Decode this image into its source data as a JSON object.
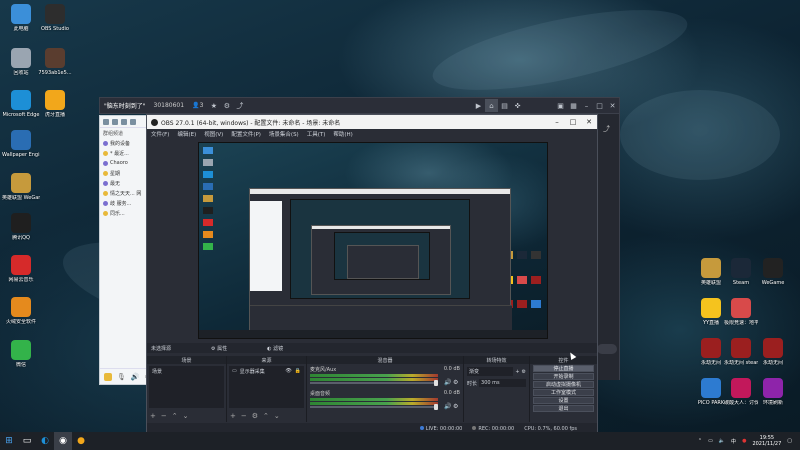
{
  "desktop": {
    "left_icons": [
      {
        "label": "此电脑",
        "icon": "computer-icon",
        "color": "#3b8fd9"
      },
      {
        "label": "OBS Studio",
        "icon": "obs-icon",
        "color": "#2d2d2d"
      },
      {
        "label": "回收站",
        "icon": "recycle-bin-icon",
        "color": "#9aa5b1"
      },
      {
        "label": "7593ab1e5...",
        "icon": "image-file-icon",
        "color": "#5a3d2f"
      },
      {
        "label": "Microsoft Edge",
        "icon": "edge-icon",
        "color": "#1d8fd6"
      },
      {
        "label": "虎牙直播",
        "icon": "huya-icon",
        "color": "#f2a71b"
      },
      {
        "label": "Wallpaper Engine:...",
        "icon": "wallpaper-engine-icon",
        "color": "#2a6db3"
      },
      {
        "label": "英雄联盟 WeGame版",
        "icon": "lol-icon",
        "color": "#c69a3c"
      },
      {
        "label": "腾讯QQ",
        "icon": "qq-icon",
        "color": "#1f1f1f"
      },
      {
        "label": "网易云音乐",
        "icon": "netease-music-icon",
        "color": "#d62a2a"
      },
      {
        "label": "火绒安全软件",
        "icon": "huorong-icon",
        "color": "#e58a1d"
      },
      {
        "label": "微信",
        "icon": "wechat-icon",
        "color": "#33b34a"
      }
    ],
    "right_icons": [
      {
        "label": "英雄联盟",
        "icon": "lol-icon",
        "color": "#c69a3c"
      },
      {
        "label": "Steam",
        "icon": "steam-icon",
        "color": "#1b2838"
      },
      {
        "label": "WeGame",
        "icon": "wegame-icon",
        "color": "#222"
      },
      {
        "label": "YY直播",
        "icon": "yy-icon",
        "color": "#f5c31e"
      },
      {
        "label": "极限竞速：地平线 4",
        "icon": "forza-icon",
        "color": "#d84a4a"
      },
      {
        "label": "",
        "icon": "",
        "color": ""
      },
      {
        "label": "永劫无间",
        "icon": "naraka-icon",
        "color": "#9b1f1f"
      },
      {
        "label": "永劫无间 steam",
        "icon": "naraka-icon",
        "color": "#9b1f1f"
      },
      {
        "label": "永劫无间",
        "icon": "naraka-icon",
        "color": "#9b1f1f"
      },
      {
        "label": "PICO PARK",
        "icon": "pico-park-icon",
        "color": "#2d7bd1"
      },
      {
        "label": "碳酸大人：讨伐...",
        "icon": "game-icon",
        "color": "#c2185b"
      },
      {
        "label": "环境刷新",
        "icon": "refresh-icon",
        "color": "#8e24aa"
      }
    ]
  },
  "qq": {
    "rows": [
      "我的设备",
      "* 最近... ",
      "Chaoro",
      "星期",
      "最无",
      "情之天天... 网",
      "歧 服务... ",
      "同乐..."
    ],
    "toolbar_label": "群组频道"
  },
  "obs_back": {
    "title": "\"脑东时刻到了\"",
    "room": "30180601",
    "count": "3"
  },
  "obs": {
    "title": "OBS 27.0.1 (64-bit, windows) - 配置文件: 未命名 - 场景: 未命名",
    "menu": [
      "文件(F)",
      "编辑(E)",
      "视图(V)",
      "配置文件(P)",
      "场景集合(S)",
      "工具(T)",
      "帮助(H)"
    ],
    "scene_bar_left": "未选择源",
    "scene_bar_props": "属性",
    "scene_bar_filters": "滤镜",
    "docks": {
      "scenes_header": "场景",
      "scene_item": "场景",
      "sources_header": "来源",
      "source_item": "显示器采集",
      "mixer_header": "混音器",
      "mixer_tracks": [
        {
          "name": "麦克风/Aux",
          "value": "0.0 dB"
        },
        {
          "name": "桌面音频",
          "value": "0.0 dB"
        }
      ],
      "transitions_header": "转场特效",
      "transition_type": "渐变",
      "duration_label": "时长",
      "duration_value": "300 ms",
      "controls_header": "控件",
      "controls": [
        "停止直播",
        "开始录制",
        "启动虚拟摄像机",
        "工作室模式",
        "设置",
        "退出"
      ]
    },
    "status": {
      "live": "LIVE: 00:00:00",
      "rec": "REC: 00:00:00",
      "cpu": "CPU: 0.7%, 60.00 fps"
    }
  },
  "taskbar": {
    "time": "19:55",
    "date": "2021/11/27",
    "lang": "中"
  }
}
